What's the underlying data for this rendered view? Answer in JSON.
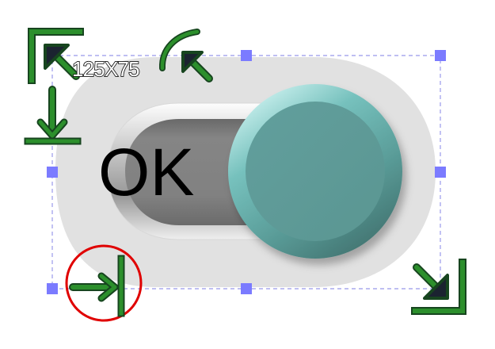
{
  "widget": {
    "type": "toggle-switch",
    "state_label": "OK",
    "size_label": "125X75"
  },
  "colors": {
    "outline_fill": "#e1e1e1",
    "track_fill": "#818181",
    "knob_fill": "#5e9c99",
    "knob_edge": "#78c5c1",
    "handle_fill": "#7b7bff",
    "selection_dash": "#a9a9ee",
    "tool_green": "#2c8f2c",
    "tool_outline": "#17451f",
    "highlight_ring": "#e00000"
  },
  "tools": {
    "resize_corner_tl": "resize-top-left-icon",
    "rotate": "rotate-icon",
    "move_down": "move-down-icon",
    "move_right": "move-right-icon",
    "resize_corner_br": "resize-bottom-right-icon"
  }
}
